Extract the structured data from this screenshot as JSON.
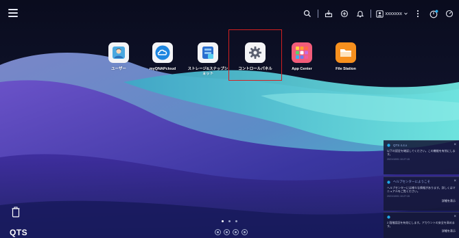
{
  "apps": [
    {
      "label": "ユーザー"
    },
    {
      "label": "myQNAPcloud"
    },
    {
      "label": "ストレージ&スナップショット"
    },
    {
      "label": "コントロールパネル"
    },
    {
      "label": "App Center"
    },
    {
      "label": "File Station"
    }
  ],
  "topbar": {
    "user_name": "xxxxxxx"
  },
  "notifications": [
    {
      "title": "QTS 4.4.x",
      "body": "以下の設定を確認してください。この機能を有効にします。",
      "time": "2021/10/01 10:27:15",
      "link": ""
    },
    {
      "title": "ヘルプセンターにようこそ",
      "body": "ヘルプセンターには様々な情報があります。詳しくはマニュアルをご覧ください。",
      "time": "2021/10/01 10:27:15",
      "link": "詳細を表示"
    },
    {
      "title": "",
      "body": "2 段階認証を有効にします。アカウントの安全を高めます。",
      "time": "2021/10/01 10:27:15",
      "link": "詳細を表示"
    }
  ],
  "logo": {
    "text": "QTS"
  },
  "colors": {
    "accent": "#1fa8e8",
    "highlight": "#d42020",
    "teal": "#5fd6d6"
  }
}
